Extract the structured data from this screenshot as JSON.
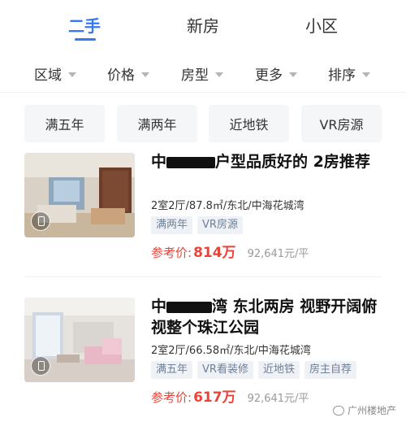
{
  "tabs": {
    "items": [
      {
        "label": "二手"
      },
      {
        "label": "新房"
      },
      {
        "label": "小区"
      }
    ],
    "active_index": 0
  },
  "filters": [
    {
      "label": "区域"
    },
    {
      "label": "价格"
    },
    {
      "label": "房型"
    },
    {
      "label": "更多"
    },
    {
      "label": "排序"
    }
  ],
  "quick_chips": [
    {
      "label": "满五年"
    },
    {
      "label": "满两年"
    },
    {
      "label": "近地铁"
    },
    {
      "label": "VR房源"
    }
  ],
  "listings": [
    {
      "title_parts": [
        "中",
        "户型品质好的 2房推荐"
      ],
      "meta": "2室2厅/87.8㎡/东北/中海花城湾",
      "tags": [
        "满两年",
        "VR房源"
      ],
      "price_label": "参考价:",
      "price": "814万",
      "unit_price": "92,641元/平"
    },
    {
      "title_parts": [
        "中",
        "湾 东北两房 视野开阔俯视整个珠江公园"
      ],
      "meta": "2室2厅/66.58㎡/东北/中海花城湾",
      "tags": [
        "满五年",
        "VR看装修",
        "近地铁",
        "房主自荐"
      ],
      "price_label": "参考价:",
      "price": "617万",
      "unit_price": "92,641元/平"
    }
  ],
  "watermark": "广州楼地产",
  "colors": {
    "accent": "#3478f6",
    "price": "#e8443a",
    "tag_text": "#6f7f95"
  }
}
